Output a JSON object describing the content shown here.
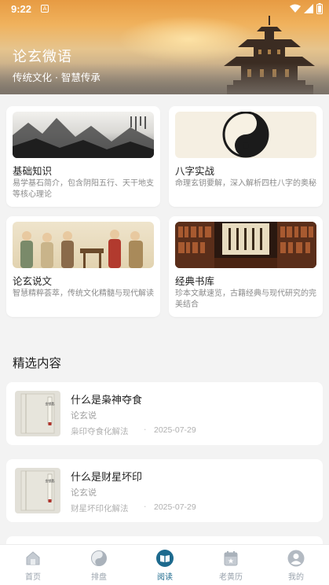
{
  "status_bar": {
    "time": "9:22",
    "notification": "A"
  },
  "hero": {
    "title": "论玄微语",
    "subtitle": "传统文化 · 智慧传承"
  },
  "categories": [
    {
      "title": "基础知识",
      "desc": "易学基石简介，包含阴阳五行、天干地支等核心理论",
      "icon": "ink-mountains-image"
    },
    {
      "title": "八字实战",
      "desc": "命理玄钥要解，深入解析四柱八字的奥秘",
      "icon": "yin-yang-image"
    },
    {
      "title": "论玄说文",
      "desc": "智慧精粹荟萃，传统文化精髓与现代解读",
      "icon": "sages-painting-image"
    },
    {
      "title": "经典书库",
      "desc": "珍本文献速览，古籍经典与现代研究的完美结合",
      "icon": "library-image"
    }
  ],
  "featured": {
    "heading": "精选内容",
    "items": [
      {
        "title": "什么是枭神夺食",
        "author": "论玄说",
        "tag": "枭印夺食化解法",
        "date": "2025-07-29",
        "cover_text": "金锁匙"
      },
      {
        "title": "什么是财星坏印",
        "author": "论玄说",
        "tag": "财星坏印化解法",
        "date": "2025-07-29",
        "cover_text": "金锁匙"
      }
    ]
  },
  "nav": [
    {
      "label": "首页",
      "icon": "home-icon",
      "active": false
    },
    {
      "label": "排盘",
      "icon": "yin-yang-icon",
      "active": false
    },
    {
      "label": "阅读",
      "icon": "book-icon",
      "active": true
    },
    {
      "label": "老黄历",
      "icon": "calendar-icon",
      "active": false
    },
    {
      "label": "我的",
      "icon": "profile-icon",
      "active": false
    }
  ],
  "colors": {
    "accent": "#1d6a8e",
    "background": "#f3f3f3",
    "card": "#ffffff"
  }
}
